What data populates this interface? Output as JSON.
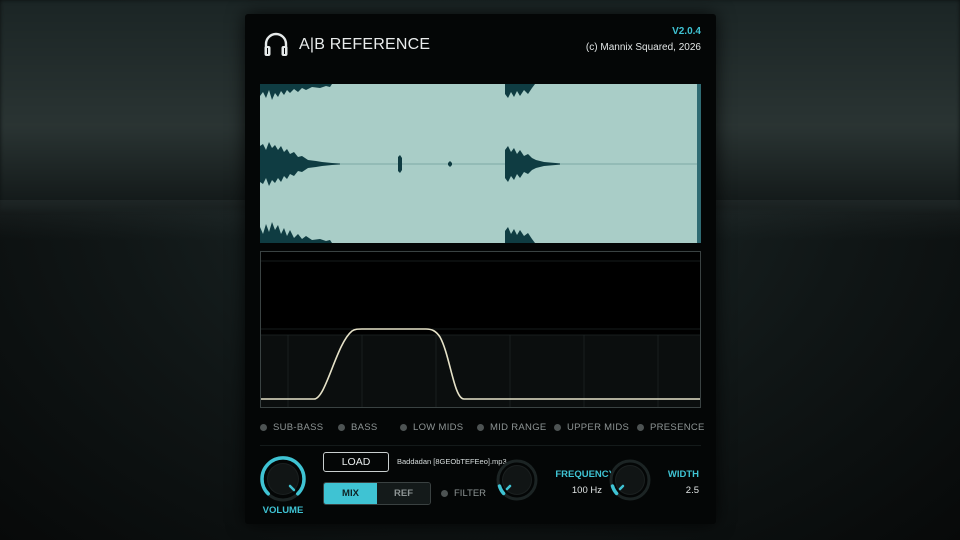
{
  "header": {
    "title": "A|B REFERENCE",
    "version": "V2.0.4",
    "copyright": "(c) Mannix Squared, 2026",
    "logo_icon": "headphones-icon"
  },
  "bands": [
    {
      "label": "SUB-BASS"
    },
    {
      "label": "BASS"
    },
    {
      "label": "LOW MIDS"
    },
    {
      "label": "MID RANGE"
    },
    {
      "label": "UPPER MIDS"
    },
    {
      "label": "PRESENCE"
    }
  ],
  "controls": {
    "volume_label": "VOLUME",
    "load_label": "LOAD",
    "filename": "Baddadan [8GEObTEFEeo].mp3",
    "mix_label": "MIX",
    "ref_label": "REF",
    "filter_label": "FILTER",
    "frequency_label": "FREQUENCY",
    "frequency_value": "100 Hz",
    "width_label": "WIDTH",
    "width_value": "2.5"
  },
  "colors": {
    "accent": "#3fc3d3",
    "waveform_bg": "#a9cdc7",
    "waveform_fg": "#0f3c42",
    "eq_curve": "#e6e2c8",
    "panel_bg": "#040606"
  }
}
